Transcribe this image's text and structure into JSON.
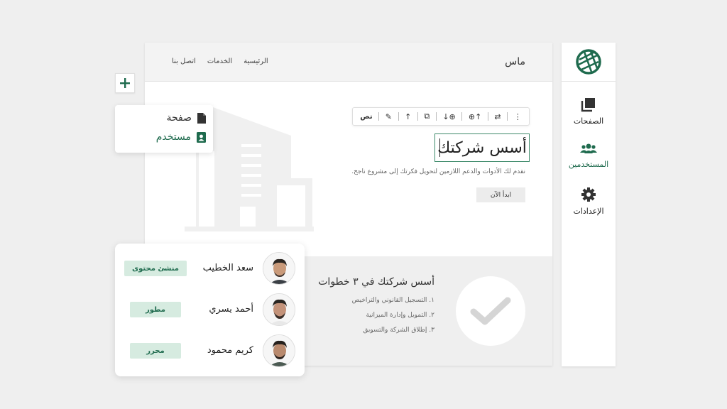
{
  "sidebar": {
    "items": [
      {
        "label": "الصفحات",
        "icon": "pages-icon"
      },
      {
        "label": "المستخدمين",
        "icon": "users-icon"
      },
      {
        "label": "الإعدادات",
        "icon": "settings-icon"
      }
    ],
    "active_index": 1
  },
  "site": {
    "brand": "ماس",
    "nav": [
      "الرئيسية",
      "الخدمات",
      "اتصل بنا"
    ]
  },
  "toolbar": {
    "text_label": "نص",
    "icons": [
      "edit-icon",
      "move-up-icon",
      "duplicate-icon",
      "insert-below-icon",
      "insert-above-icon",
      "swap-icon",
      "more-icon"
    ]
  },
  "hero": {
    "title": "أسس شركتك",
    "description": "نقدم لك الأدوات والدعم اللازمين لتحويل فكرتك إلى مشروع ناجح.",
    "button": "ابدأ الآن"
  },
  "steps": {
    "title": "أسس شركتك في ٣ خطوات",
    "items": [
      "١. التسجيل القانوني والتراخيص",
      "٢. التمويل وإدارة الميزانية",
      "٣. إطلاق الشركة والتسويق"
    ]
  },
  "add_menu": {
    "items": [
      {
        "label": "صفحة",
        "icon": "file-icon"
      },
      {
        "label": "مستخدم",
        "icon": "user-card-icon"
      }
    ]
  },
  "users": [
    {
      "name": "سعد الخطيب",
      "role": "منشئ محتوى"
    },
    {
      "name": "أحمد يسري",
      "role": "مطور"
    },
    {
      "name": "كريم محمود",
      "role": "محرر"
    }
  ],
  "colors": {
    "accent": "#1f6b4e",
    "badge_bg": "#d6ebe0",
    "background": "#efefef"
  }
}
